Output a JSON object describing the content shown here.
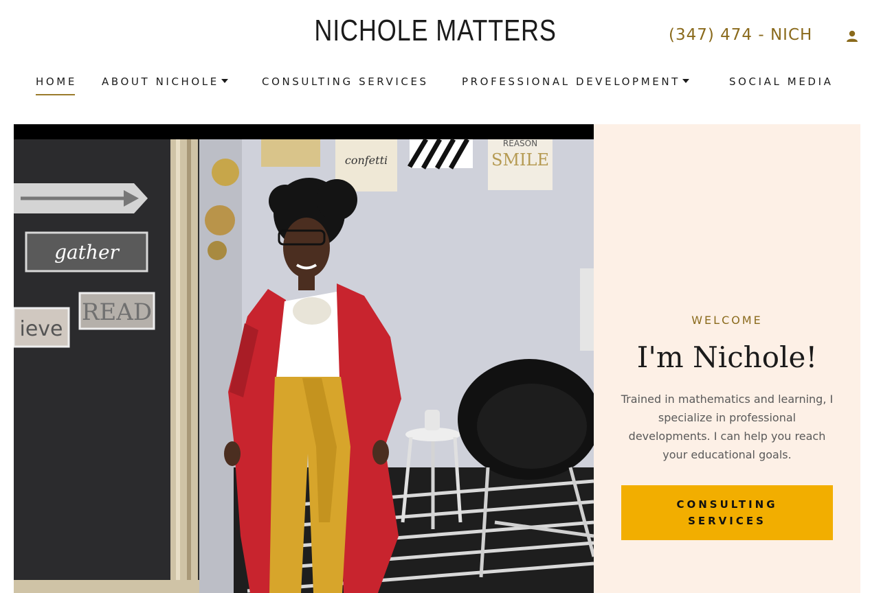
{
  "header": {
    "site_title": "NICHOLE MATTERS",
    "phone": "(347) 474 - NICH",
    "account_icon": "user-icon"
  },
  "nav": {
    "items": [
      {
        "label": "HOME",
        "active": true,
        "has_dropdown": false
      },
      {
        "label": "ABOUT NICHOLE",
        "active": false,
        "has_dropdown": true
      },
      {
        "label": "CONSULTING SERVICES",
        "active": false,
        "has_dropdown": false
      },
      {
        "label": "PROFESSIONAL DEVELOPMENT",
        "active": false,
        "has_dropdown": true
      },
      {
        "label": "SOCIAL MEDIA",
        "active": false,
        "has_dropdown": false
      }
    ]
  },
  "hero": {
    "eyebrow": "WELCOME",
    "headline": "I'm Nichole!",
    "blurb": "Trained in mathematics and learning, I specialize in professional developments.  I can help you reach your educational goals.",
    "cta_label": "CONSULTING SERVICES",
    "sign_gather": "gather",
    "sign_read": "READ",
    "sign_believe": "ieve",
    "poster_confetti": "confetti",
    "poster_smile": "SMILE",
    "poster_reason": "REASON"
  },
  "colors": {
    "accent_gold": "#8a6a1c",
    "cta_yellow": "#f2ae00",
    "panel_bg": "#fdf0e6"
  }
}
